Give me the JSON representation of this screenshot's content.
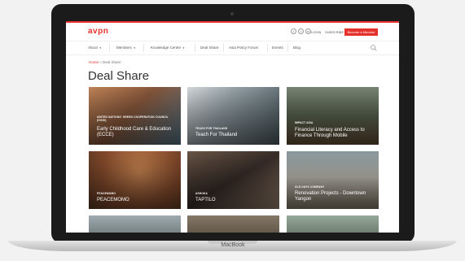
{
  "device": {
    "label": "MacBook"
  },
  "colors": {
    "brand": "#e6322c",
    "text": "#333333"
  },
  "header": {
    "logo": "avpn",
    "social_icons": [
      "twitter-icon",
      "facebook-icon",
      "linkedin-icon"
    ],
    "login": "LOGIN",
    "subscribe": "SUBSCRIBE",
    "cta": "Become a Member"
  },
  "nav": {
    "items": [
      {
        "label": "About",
        "caret": "▼"
      },
      {
        "label": "Members",
        "caret": "▼"
      },
      {
        "label": "Knowledge Centre",
        "caret": "▼"
      },
      {
        "label": "Deal Share"
      },
      {
        "label": "Asia Policy Forum"
      },
      {
        "label": "Events"
      },
      {
        "label": "Blog"
      }
    ]
  },
  "breadcrumb": {
    "home": "Home",
    "separator": " » ",
    "current": "Deal Share"
  },
  "page_title": "Deal Share",
  "cards": [
    {
      "tag": "UNITED NATIONS' GREEN COOPERATION COUNCIL (GGGI)",
      "title": "Early Childhood Care & Education (ECCE)"
    },
    {
      "tag": "TEACH FOR THAILAND",
      "title": "Teach For Thailand"
    },
    {
      "tag": "IMPACT ASIA",
      "title": "Financial Literacy and Access to Finance Through Mobile"
    },
    {
      "tag": "PEACEMOMO",
      "title": "PEACEMOMO"
    },
    {
      "tag": "ASHOKA",
      "title": "TAPTILO"
    },
    {
      "tag": "OLD DAYS COMPANY",
      "title": "Renovation Projects - Downtown Yangon"
    }
  ]
}
